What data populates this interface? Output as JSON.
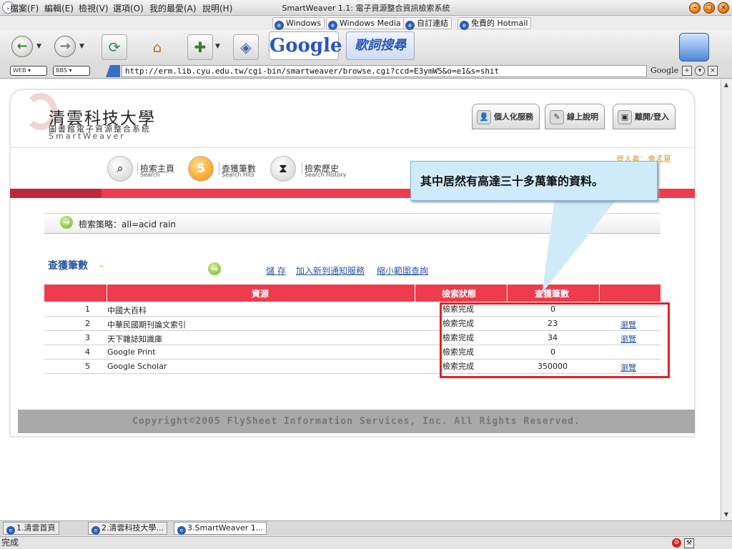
{
  "window": {
    "title": "SmartWeaver 1.1: 電子資源整合資訊檢索系統"
  },
  "menu": [
    "檔案(F)",
    "編輯(E)",
    "檢視(V)",
    "選項(O)",
    "我的最愛(A)",
    "說明(H)"
  ],
  "bookmarks": [
    "Windows",
    "Windows Media",
    "自訂連結",
    "免費的 Hotmail"
  ],
  "toolbar": {
    "google": "Google",
    "lyrics": "歌詞搜尋"
  },
  "addressbar": {
    "pill_web": "WEB ▾",
    "pill_bbs": "BBS ▾",
    "url": "http://erm.lib.cyu.edu.tw/cgi-bin/smartweaver/browse.cgi?ccd=E3ymW5&o=e1&s=shit",
    "search_engine": "Google"
  },
  "site": {
    "title": "清雲科技大學",
    "subtitle": "圖書館電子資源整合系統",
    "brand": "SmartWeaver",
    "top_nav": [
      "個人化服務",
      "線上說明",
      "離開/登入"
    ],
    "nav": [
      {
        "label": "檢索主頁",
        "sub": "Search"
      },
      {
        "label": "查獲筆數",
        "sub": "Search Hits"
      },
      {
        "label": "檢索歷史",
        "sub": "Search History"
      }
    ],
    "login": "登入者：會孟夏",
    "strategy": "檢索策略：all=acid rain",
    "hits_heading": "查獲筆數",
    "actions": [
      "儲 存",
      "加入新到通知服務",
      "縮小範圍查詢"
    ],
    "footer": "Copyright©2005 FlySheet Information Services, Inc. All Rights Reserved."
  },
  "table": {
    "headers": [
      "資源",
      "檢索狀態",
      "查獲筆數"
    ],
    "rows": [
      {
        "no": "1",
        "source": "中國大百科",
        "status": "檢索完成",
        "hits": "0",
        "browse": ""
      },
      {
        "no": "2",
        "source": "中華民國期刊論文索引",
        "status": "檢索完成",
        "hits": "23",
        "browse": "瀏覽"
      },
      {
        "no": "3",
        "source": "天下雜誌知識庫",
        "status": "檢索完成",
        "hits": "34",
        "browse": "瀏覽"
      },
      {
        "no": "4",
        "source": "Google Print",
        "status": "檢索完成",
        "hits": "0",
        "browse": ""
      },
      {
        "no": "5",
        "source": "Google Scholar",
        "status": "檢索完成",
        "hits": "350000",
        "browse": "瀏覽"
      }
    ]
  },
  "callout": "其中居然有高達三十多萬筆的資料。",
  "tabs": [
    "1.清雲首頁",
    "2.清雲科技大學...",
    "3.SmartWeaver 1..."
  ],
  "status": "完成"
}
